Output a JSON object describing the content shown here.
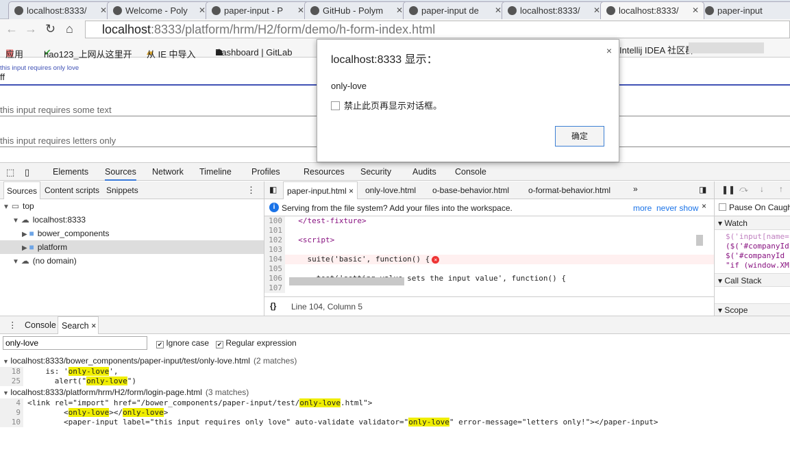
{
  "browser": {
    "tabs": [
      {
        "title": "localhost:8333/",
        "active": false
      },
      {
        "title": "Welcome - Poly",
        "active": false
      },
      {
        "title": "paper-input - P",
        "active": false
      },
      {
        "title": "GitHub - Polym",
        "active": false
      },
      {
        "title": "paper-input de",
        "active": false
      },
      {
        "title": "localhost:8333/",
        "active": false
      },
      {
        "title": "localhost:8333/",
        "active": true
      },
      {
        "title": "paper-input",
        "active": false
      }
    ],
    "url_host": "localhost",
    "url_rest": ":8333/platform/hrm/H2/form/demo/h-form-index.html",
    "bookmarks": [
      "应用",
      "hao123_上网从这里开",
      "从 IE 中导入",
      "Dashboard | GitLab",
      "Intellij IDEA 社区群"
    ]
  },
  "page": {
    "inputs": [
      {
        "label": "this input requires only love",
        "value": "ff",
        "focused": true
      },
      {
        "label": "this input requires some text",
        "value": ""
      },
      {
        "label": "this input requires letters only",
        "value": ""
      }
    ]
  },
  "dialog": {
    "title": "localhost:8333 显示：",
    "message": "only-love",
    "checkbox_label": "禁止此页再显示对话框。",
    "ok_label": "确定",
    "close": "×"
  },
  "devtools": {
    "tabs": [
      "Elements",
      "Sources",
      "Network",
      "Timeline",
      "Profiles",
      "Resources",
      "Security",
      "Audits",
      "Console"
    ],
    "active_tab": "Sources",
    "navigator_tabs": [
      "Sources",
      "Content scripts",
      "Snippets"
    ],
    "tree": [
      {
        "label": "top",
        "depth": 0,
        "icon": "frame-icon"
      },
      {
        "label": "localhost:8333",
        "depth": 1,
        "icon": "cloud-icon"
      },
      {
        "label": "bower_components",
        "depth": 2,
        "icon": "folder-icon"
      },
      {
        "label": "platform",
        "depth": 2,
        "icon": "folder-icon",
        "selected": true
      },
      {
        "label": "(no domain)",
        "depth": 1,
        "icon": "cloud-icon"
      }
    ],
    "editor_tabs": [
      "paper-input.html",
      "only-love.html",
      "o-base-behavior.html",
      "o-format-behavior.html"
    ],
    "overflow": "»",
    "infobar": {
      "text": "Serving from the file system? Add your files into the workspace.",
      "more": "more",
      "never_show": "never show"
    },
    "code": [
      {
        "n": "100",
        "text": "  </test-fixture>"
      },
      {
        "n": "101",
        "text": ""
      },
      {
        "n": "102",
        "text": "  <script>"
      },
      {
        "n": "103",
        "text": ""
      },
      {
        "n": "104",
        "text": "    suite('basic', function() {",
        "error": true
      },
      {
        "n": "105",
        "text": ""
      },
      {
        "n": "106",
        "text": "      test('setting value sets the input value', function() {"
      },
      {
        "n": "107",
        "text": ""
      }
    ],
    "status": "Line 104, Column 5",
    "right": {
      "pause_label": "Pause On Caught",
      "watch": "Watch",
      "watch_items": [
        "$('input[name=",
        "($('#companyId",
        "$('#companyId (",
        "\"if (window.XM"
      ],
      "call_stack": "Call Stack",
      "scope": "Scope"
    },
    "drawer": {
      "tabs": [
        "Console",
        "Search"
      ],
      "query": "only-love",
      "ignore_case": "Ignore case",
      "ignore_case_checked": true,
      "regex": "Regular expression",
      "regex_checked": true,
      "results": [
        {
          "file": "localhost:8333/bower_components/paper-input/test/only-love.html",
          "count": "(2 matches)",
          "lines": [
            {
              "n": "18",
              "segs": [
                [
                  "    is: '",
                  0
                ],
                [
                  "only-love",
                  1
                ],
                [
                  "',",
                  0
                ]
              ]
            },
            {
              "n": "25",
              "segs": [
                [
                  "      alert(\"",
                  0
                ],
                [
                  "only-love",
                  1
                ],
                [
                  "\")",
                  0
                ]
              ]
            }
          ]
        },
        {
          "file": "localhost:8333/platform/hrm/H2/form/login-page.html",
          "count": "(3 matches)",
          "lines": [
            {
              "n": "4",
              "segs": [
                [
                  "<link rel=\"import\" href=\"/bower_components/paper-input/test/",
                  0
                ],
                [
                  "only-love",
                  1
                ],
                [
                  ".html\">",
                  0
                ]
              ]
            },
            {
              "n": "9",
              "segs": [
                [
                  "        <",
                  0
                ],
                [
                  "only-love",
                  1
                ],
                [
                  "></",
                  0
                ],
                [
                  "only-love",
                  1
                ],
                [
                  ">",
                  0
                ]
              ]
            },
            {
              "n": "10",
              "segs": [
                [
                  "        <paper-input label=\"this input requires only love\" auto-validate validator=\"",
                  0
                ],
                [
                  "only-love",
                  1
                ],
                [
                  "\" error-message=\"letters only!\"></paper-input>",
                  0
                ]
              ]
            }
          ]
        }
      ]
    }
  }
}
